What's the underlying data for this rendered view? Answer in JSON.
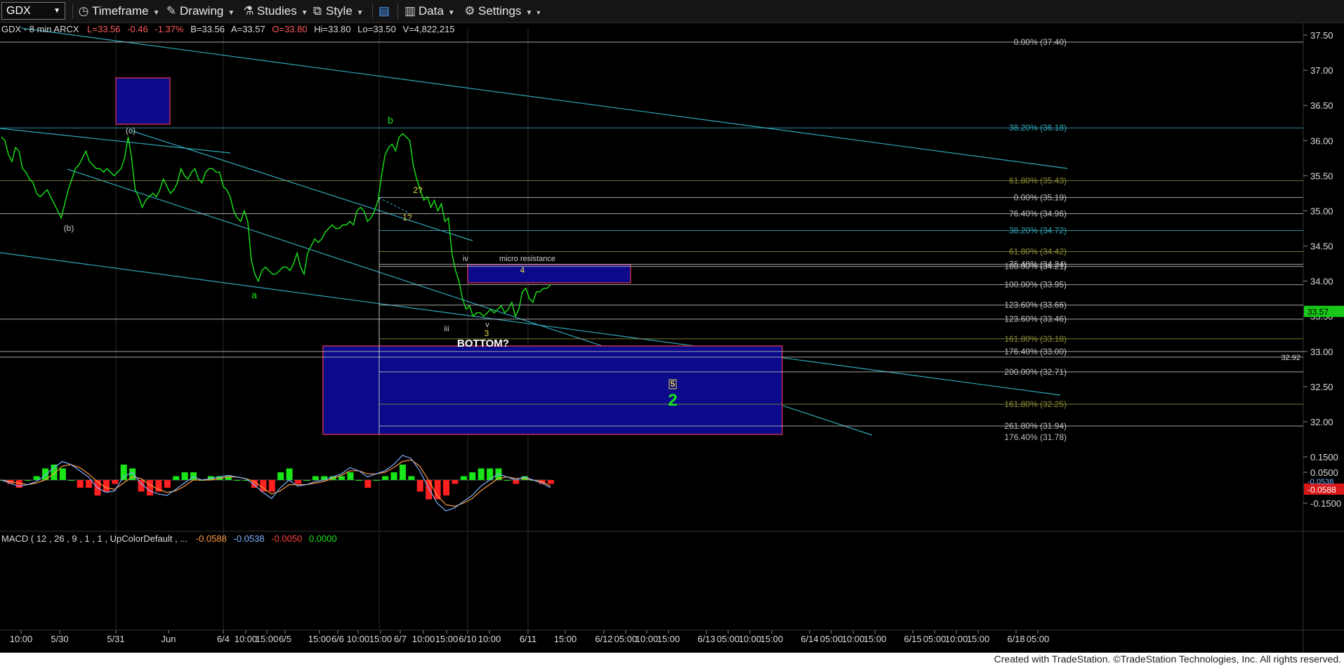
{
  "toolbar": {
    "symbol": "GDX",
    "timeframe_label": "Timeframe",
    "drawing_label": "Drawing",
    "studies_label": "Studies",
    "style_label": "Style",
    "data_label": "Data",
    "settings_label": "Settings"
  },
  "header_line": {
    "prefix": "GDX - 8 min  ARCX",
    "last": "L=33.56",
    "chg": "-0.46",
    "pct": "-1.37%",
    "bid": "B=33.56",
    "ask": "A=33.57",
    "open": "O=33.80",
    "high": "Hi=33.80",
    "low": "Lo=33.50",
    "vol": "V=4,822,215"
  },
  "macd_header": {
    "label": "MACD ( 12 , 26 , 9 , 1 , 1 , UpColorDefault , ...",
    "v1": "-0.0588",
    "v2": "-0.0538",
    "v3": "-0.0050",
    "v4": "0.0000"
  },
  "footer": "Created with TradeStation. ©TradeStation Technologies, Inc. All rights reserved.",
  "colors": {
    "price": "#19e619",
    "trendline": "#2fa6b8",
    "fib_white": "#bfbfbf",
    "fib_olive": "#8c8c3a",
    "box_fill": "#0a0a8a",
    "box_border": "#c0304a",
    "macd_line1": "#7fb0ff",
    "macd_line2": "#ff9a40",
    "hist_pos": "#19e619",
    "hist_neg": "#ff2020"
  },
  "chart_data": {
    "type": "line",
    "title": "GDX - 8 min",
    "price_axis": {
      "range": [
        31.75,
        37.75
      ],
      "ticks": [
        "37.50",
        "37.00",
        "36.50",
        "36.00",
        "35.50",
        "35.00",
        "34.50",
        "34.00",
        "33.50",
        "33.00",
        "32.50",
        "32.00"
      ],
      "last_price_tag": "33.57",
      "extra_tag": "32.92"
    },
    "x_axis": {
      "labels": [
        "10:00",
        "5/30",
        "5/31",
        "Jun",
        "6/4",
        "10:00",
        "15:00",
        "6/5",
        "15:00",
        "6/6",
        "10:00",
        "15:00",
        "6/7",
        "10:00",
        "15:00",
        "6/10",
        "10:00",
        "6/11",
        "15:00",
        "6/12",
        "05:00",
        "10:00",
        "15:00",
        "6/13",
        "05:00",
        "10:00",
        "15:00",
        "6/14",
        "05:00",
        "10:00",
        "15:00",
        "6/15",
        "05:00",
        "10:00",
        "15:00",
        "6/18",
        "05:00"
      ]
    },
    "price_series": {
      "name": "GDX",
      "x": [
        0,
        5,
        10,
        15,
        20,
        25,
        30,
        35,
        40,
        45,
        50,
        55,
        60,
        65,
        70,
        75,
        80,
        85,
        90,
        95,
        100,
        105,
        110,
        115,
        120,
        125,
        130,
        135,
        140,
        145,
        150,
        155,
        160,
        165,
        170,
        175,
        180,
        185,
        190,
        195,
        200,
        205,
        210,
        215,
        220,
        225,
        230,
        235,
        240,
        245,
        250,
        255,
        260,
        265,
        270,
        275,
        280,
        285,
        290,
        295,
        300,
        305,
        310,
        315,
        320,
        325,
        330,
        335,
        340,
        345,
        350,
        355,
        360,
        365,
        370,
        375,
        380,
        385,
        390,
        395,
        400,
        405,
        410,
        415,
        420,
        425,
        430,
        435,
        440,
        445,
        450,
        455,
        460,
        465,
        470,
        475,
        480,
        485,
        490,
        495,
        500,
        505,
        510,
        515,
        520,
        525,
        530,
        535,
        540,
        545,
        550,
        555,
        560,
        565,
        570,
        575,
        580,
        585,
        590,
        595,
        600,
        605,
        610,
        615,
        620,
        625,
        630,
        635,
        640,
        645,
        650,
        655,
        660,
        665,
        670,
        675,
        680,
        685,
        690,
        695,
        700,
        705,
        710,
        715,
        720,
        725,
        730,
        735,
        740,
        745,
        750,
        755,
        760,
        765,
        770,
        775,
        780
      ],
      "y": [
        36.05,
        36.0,
        35.8,
        35.7,
        35.9,
        35.85,
        35.6,
        35.55,
        35.45,
        35.4,
        35.25,
        35.2,
        35.25,
        35.3,
        35.2,
        35.1,
        35.0,
        34.9,
        35.1,
        35.3,
        35.45,
        35.6,
        35.65,
        35.75,
        35.85,
        35.7,
        35.65,
        35.6,
        35.6,
        35.55,
        35.6,
        35.55,
        35.5,
        35.55,
        35.6,
        35.75,
        36.05,
        35.75,
        35.3,
        35.2,
        35.05,
        35.15,
        35.2,
        35.25,
        35.2,
        35.3,
        35.45,
        35.35,
        35.25,
        35.3,
        35.4,
        35.6,
        35.5,
        35.45,
        35.55,
        35.6,
        35.45,
        35.4,
        35.55,
        35.6,
        35.6,
        35.55,
        35.55,
        35.35,
        35.3,
        35.2,
        35.0,
        34.9,
        34.85,
        35.0,
        34.85,
        34.3,
        34.1,
        34.0,
        34.15,
        34.2,
        34.15,
        34.1,
        34.1,
        34.15,
        34.2,
        34.2,
        34.15,
        34.25,
        34.4,
        34.2,
        34.1,
        34.4,
        34.5,
        34.6,
        34.55,
        34.6,
        34.7,
        34.75,
        34.8,
        34.75,
        34.75,
        34.8,
        34.8,
        34.85,
        34.8,
        35.0,
        35.05,
        35.0,
        34.85,
        34.9,
        35.0,
        35.15,
        35.5,
        35.8,
        35.9,
        35.95,
        35.85,
        36.05,
        36.1,
        36.05,
        36.0,
        35.65,
        35.45,
        35.3,
        35.15,
        35.2,
        35.05,
        35.15,
        35.0,
        35.1,
        34.85,
        34.9,
        34.4,
        34.15,
        34.0,
        33.75,
        33.6,
        33.65,
        33.5,
        33.55,
        33.55,
        33.5,
        33.55,
        33.6,
        33.55,
        33.6,
        33.65,
        33.55,
        33.6,
        33.7,
        33.5,
        33.6,
        33.85,
        33.9,
        33.75,
        33.7,
        33.85,
        33.85,
        33.9,
        33.9,
        33.95,
        34.0,
        34.05,
        34.05,
        34.0,
        33.95
      ],
      "note_x": "bar index"
    },
    "macd": {
      "range": [
        -0.2,
        0.22
      ],
      "ticks": [
        "0.1500",
        "0.0500",
        "-0.0500",
        "-0.1500"
      ],
      "tags": [
        "-0.0588",
        "-0.0538"
      ],
      "line1": [
        0.0,
        -0.02,
        -0.04,
        -0.03,
        -0.01,
        0.03,
        0.08,
        0.12,
        0.1,
        0.06,
        0.02,
        -0.05,
        -0.08,
        -0.07,
        0.02,
        0.05,
        -0.02,
        -0.07,
        -0.09,
        -0.1,
        -0.06,
        -0.02,
        0.02,
        0.0,
        0.01,
        0.02,
        0.03,
        0.02,
        0.01,
        -0.03,
        -0.08,
        -0.12,
        -0.05,
        0.0,
        -0.04,
        -0.03,
        -0.01,
        0.0,
        0.02,
        0.04,
        0.08,
        0.06,
        0.02,
        0.04,
        0.06,
        0.1,
        0.16,
        0.14,
        0.06,
        -0.05,
        -0.15,
        -0.2,
        -0.18,
        -0.14,
        -0.1,
        -0.04,
        0.0,
        0.04,
        0.02,
        0.0,
        0.02,
        0.0,
        -0.02,
        -0.05
      ],
      "line2": [
        0.0,
        -0.01,
        -0.02,
        -0.03,
        -0.02,
        0.0,
        0.04,
        0.09,
        0.1,
        0.08,
        0.04,
        -0.01,
        -0.05,
        -0.06,
        -0.02,
        0.02,
        0.01,
        -0.03,
        -0.06,
        -0.08,
        -0.07,
        -0.04,
        0.0,
        0.0,
        0.0,
        0.01,
        0.02,
        0.02,
        0.01,
        -0.01,
        -0.05,
        -0.09,
        -0.07,
        -0.03,
        -0.03,
        -0.03,
        -0.02,
        -0.01,
        0.01,
        0.03,
        0.06,
        0.06,
        0.04,
        0.04,
        0.05,
        0.08,
        0.12,
        0.13,
        0.09,
        0.0,
        -0.1,
        -0.16,
        -0.17,
        -0.15,
        -0.12,
        -0.07,
        -0.03,
        0.01,
        0.02,
        0.01,
        0.01,
        0.0,
        -0.01,
        -0.04
      ]
    },
    "fib_labels": [
      {
        "text": "0.00% (37.40)",
        "price": 37.4,
        "color": "white"
      },
      {
        "text": "38.20% (36.18)",
        "price": 36.18,
        "color": "teal"
      },
      {
        "text": "61.80% (35.43)",
        "price": 35.43,
        "color": "olive"
      },
      {
        "text": "0.00% (35.19)",
        "price": 35.19,
        "color": "white"
      },
      {
        "text": "76.40% (34.96)",
        "price": 34.96,
        "color": "white"
      },
      {
        "text": "38.20% (34.72)",
        "price": 34.72,
        "color": "teal"
      },
      {
        "text": "61.80% (34.42)",
        "price": 34.42,
        "color": "olive"
      },
      {
        "text": "76.40% (34.24)",
        "price": 34.24,
        "color": "white"
      },
      {
        "text": "100.00% (34.21)",
        "price": 34.21,
        "color": "white"
      },
      {
        "text": "100.00% (33.95)",
        "price": 33.95,
        "color": "white"
      },
      {
        "text": "123.60% (33.66)",
        "price": 33.66,
        "color": "white"
      },
      {
        "text": "123.60% (33.46)",
        "price": 33.46,
        "color": "white"
      },
      {
        "text": "161.80% (33.18)",
        "price": 33.18,
        "color": "olive"
      },
      {
        "text": "176.40% (33.00)",
        "price": 33.0,
        "color": "white"
      },
      {
        "text": "200.00% (32.71)",
        "price": 32.71,
        "color": "white"
      },
      {
        "text": "161.80% (32.25)",
        "price": 32.25,
        "color": "olive"
      },
      {
        "text": "261.80% (31.94)",
        "price": 31.94,
        "color": "white"
      },
      {
        "text": "176.40% (31.78)",
        "price": 31.78,
        "color": "white"
      }
    ],
    "annotations": [
      {
        "text": "(c)",
        "color": "#cccccc"
      },
      {
        "text": "(b)",
        "color": "#cccccc"
      },
      {
        "text": "a",
        "color": "#19e619"
      },
      {
        "text": "b",
        "color": "#19e619"
      },
      {
        "text": "2?",
        "color": "#e8d84a"
      },
      {
        "text": "1?",
        "color": "#e8d84a"
      },
      {
        "text": "iii",
        "color": "#cccccc"
      },
      {
        "text": "iv",
        "color": "#cccccc"
      },
      {
        "text": "v",
        "color": "#cccccc"
      },
      {
        "text": "3",
        "color": "#e8d84a"
      },
      {
        "text": "4",
        "color": "#e8d84a"
      },
      {
        "text": "micro resistance",
        "color": "#cccccc"
      },
      {
        "text": "BOTTOM?",
        "color": "#ffffff"
      },
      {
        "text": "5",
        "color": "#e8d84a"
      },
      {
        "text": "2",
        "color": "#19e619"
      }
    ]
  }
}
